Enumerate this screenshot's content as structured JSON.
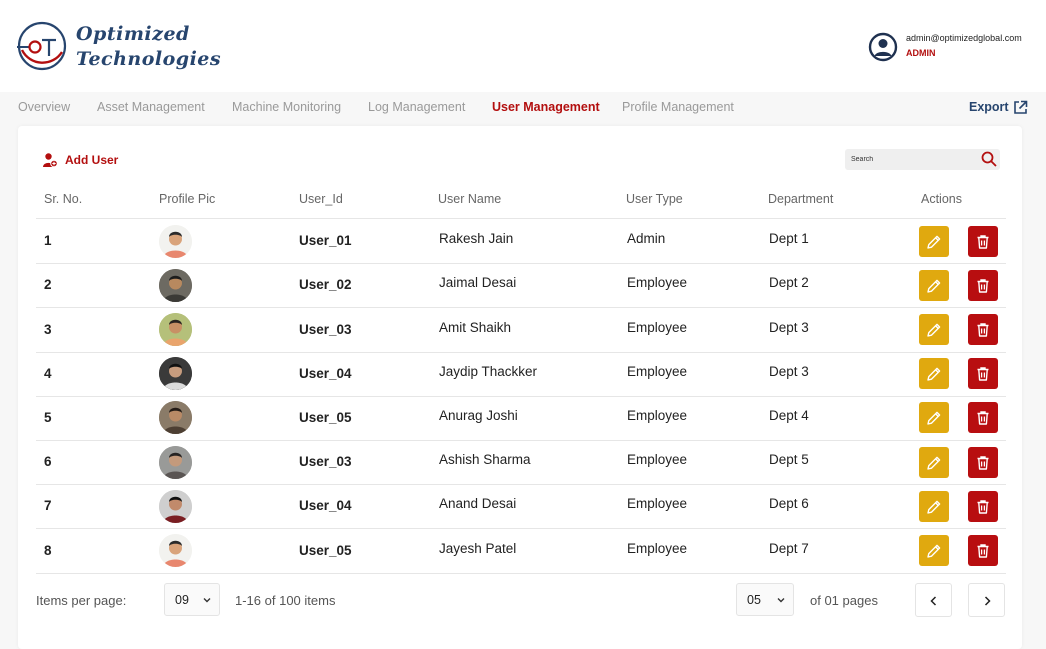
{
  "brand": {
    "line1": "Optimized",
    "line2": "Technologies",
    "logo_letters": "OT",
    "logo_color": "#27456e",
    "accent_color": "#b30f0f"
  },
  "user": {
    "email": "admin@optimizedglobal.com",
    "role": "ADMIN",
    "icon": "user-circle-icon"
  },
  "nav": {
    "tabs": [
      {
        "label": "Overview",
        "active": false
      },
      {
        "label": "Asset Management",
        "active": false
      },
      {
        "label": "Machine Monitoring",
        "active": false
      },
      {
        "label": "Log Management",
        "active": false
      },
      {
        "label": "User Management",
        "active": true
      },
      {
        "label": "Profile Management",
        "active": false
      }
    ],
    "export_label": "Export"
  },
  "toolbar": {
    "add_user_label": "Add User",
    "search_placeholder": "Search"
  },
  "table": {
    "headers": [
      "Sr. No.",
      "Profile Pic",
      "User_Id",
      "User Name",
      "User Type",
      "Department",
      "Actions"
    ],
    "rows": [
      {
        "sr": "1",
        "user_id": "User_01",
        "name": "Rakesh Jain",
        "type": "Admin",
        "dept": "Dept 1"
      },
      {
        "sr": "2",
        "user_id": "User_02",
        "name": "Jaimal Desai",
        "type": "Employee",
        "dept": "Dept 2"
      },
      {
        "sr": "3",
        "user_id": "User_03",
        "name": "Amit Shaikh",
        "type": "Employee",
        "dept": "Dept 3"
      },
      {
        "sr": "4",
        "user_id": "User_04",
        "name": "Jaydip Thackker",
        "type": "Employee",
        "dept": "Dept 3"
      },
      {
        "sr": "5",
        "user_id": "User_05",
        "name": "Anurag Joshi",
        "type": "Employee",
        "dept": "Dept 4"
      },
      {
        "sr": "6",
        "user_id": "User_03",
        "name": "Ashish Sharma",
        "type": "Employee",
        "dept": "Dept 5"
      },
      {
        "sr": "7",
        "user_id": "User_04",
        "name": "Anand Desai",
        "type": "Employee",
        "dept": "Dept 6"
      },
      {
        "sr": "8",
        "user_id": "User_05",
        "name": "Jayesh Patel",
        "type": "Employee",
        "dept": "Dept 7"
      }
    ],
    "edit_color": "#e0a90f",
    "delete_color": "#b80e10"
  },
  "pagination": {
    "items_per_page_label": "Items per page:",
    "items_per_page_value": "09",
    "range_text": "1-16 of 100 items",
    "page_value": "05",
    "pages_text": "of 01 pages"
  }
}
